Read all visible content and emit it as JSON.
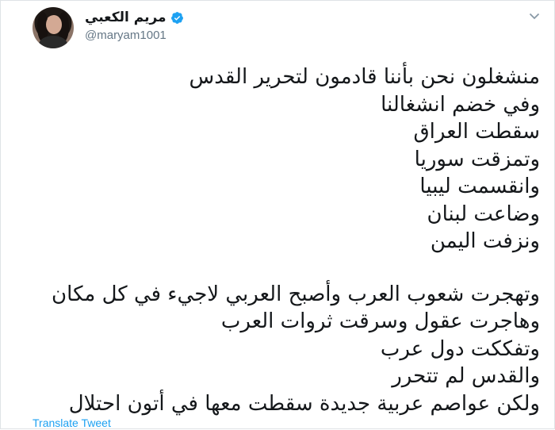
{
  "tweet": {
    "display_name": "مريم الكعبي",
    "handle": "@maryam1001",
    "lines_part1": [
      "منشغلون نحن بأننا قادمون لتحرير القدس",
      "وفي خضم انشغالنا",
      "سقطت العراق",
      "وتمزقت سوريا",
      "وانقسمت ليبيا",
      "وضاعت لبنان",
      "ونزفت اليمن"
    ],
    "lines_part2": [
      "وتهجرت شعوب العرب وأصبح العربي لاجيء في كل مكان",
      "وهاجرت عقول وسرقت ثروات العرب",
      "وتفككت دول عرب",
      "والقدس لم تتحرر",
      "ولكن عواصم عربية جديدة سقطت معها في أتون احتلال"
    ],
    "translate_label": "Translate Tweet"
  },
  "icons": {
    "verified": "verified-badge-icon",
    "menu": "chevron-down-icon"
  },
  "colors": {
    "accent": "#1da1f2",
    "text": "#14171a",
    "secondary": "#657786"
  }
}
